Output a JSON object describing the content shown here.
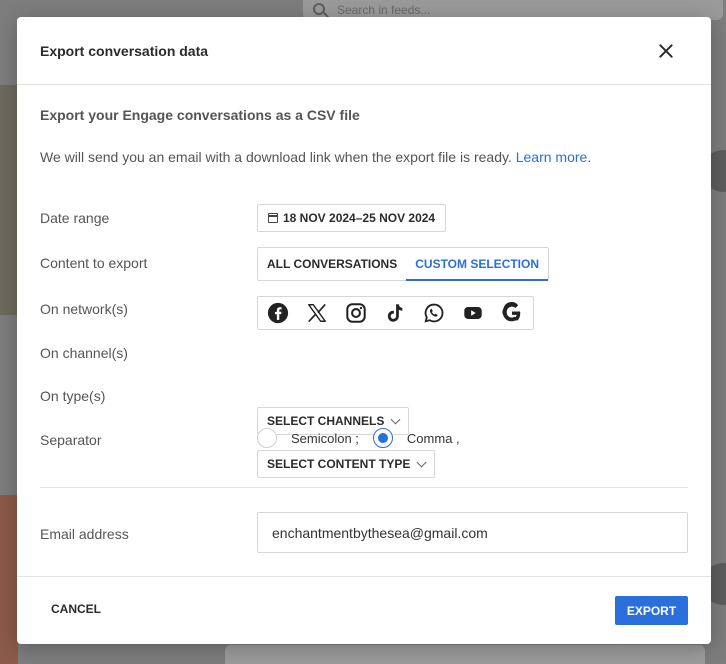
{
  "background": {
    "search_placeholder": "Search in feeds..."
  },
  "dialog": {
    "title": "Export conversation data",
    "close_icon": "close-icon",
    "subtitle": "Export your Engage conversations as a CSV file",
    "description": "We will send you an email with a download link when the export file is ready. ",
    "learn_more": "Learn more",
    "learn_more_suffix": ".",
    "date_range": {
      "label": "Date range",
      "value": "18 NOV 2024–25 NOV 2024",
      "icon": "calendar-icon"
    },
    "content": {
      "label": "Content to export",
      "options": [
        "ALL CONVERSATIONS",
        "CUSTOM SELECTION"
      ],
      "selected": "CUSTOM SELECTION"
    },
    "networks": {
      "label": "On network(s)",
      "icons": [
        "facebook-icon",
        "x-icon",
        "instagram-icon",
        "tiktok-icon",
        "whatsapp-icon",
        "youtube-icon",
        "google-icon"
      ]
    },
    "channels": {
      "label": "On channel(s)",
      "button": "SELECT CHANNELS"
    },
    "types": {
      "label": "On type(s)",
      "button": "SELECT CONTENT TYPE"
    },
    "separator": {
      "label": "Separator",
      "options": [
        "Semicolon ;",
        "Comma ,"
      ],
      "selected": "Comma ,"
    },
    "email": {
      "label": "Email address",
      "value": "enchantmentbythesea@gmail.com"
    },
    "footer": {
      "cancel": "CANCEL",
      "export": "EXPORT"
    }
  },
  "colors": {
    "accent": "#2a6fdb",
    "text": "#555555"
  }
}
